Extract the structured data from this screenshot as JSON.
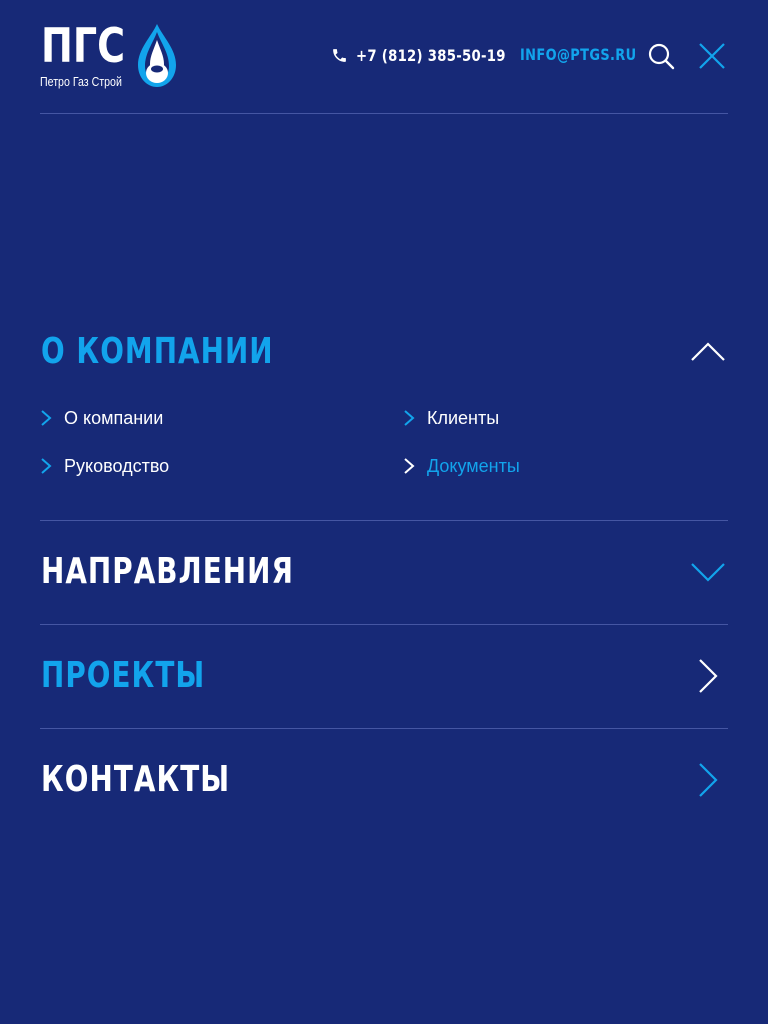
{
  "header": {
    "logo": {
      "letters": "ПГС",
      "subtitle": "Петро Газ Строй"
    },
    "phone": "+7 (812) 385-50-19",
    "email": "INFO@PTGS.RU",
    "icons": [
      "phone-icon",
      "search-icon",
      "close-icon"
    ]
  },
  "menu": {
    "sections": [
      {
        "title": "О КОМПАНИИ",
        "state": "expanded",
        "toggle_icon": "chevron-up-icon",
        "items": [
          {
            "label": "О компании",
            "color": "white"
          },
          {
            "label": "Клиенты",
            "color": "white"
          },
          {
            "label": "Руководство",
            "color": "white"
          },
          {
            "label": "Документы",
            "color": "blue"
          }
        ]
      },
      {
        "title": "НАПРАВЛЕНИЯ",
        "state": "collapsed",
        "toggle_icon": "chevron-down-icon"
      },
      {
        "title": "ПРОЕКТЫ",
        "state": "link",
        "toggle_icon": "chevron-right-icon"
      },
      {
        "title": "КОНТАКТЫ",
        "state": "link",
        "toggle_icon": "chevron-right-icon"
      }
    ]
  },
  "colors": {
    "background": "#172977",
    "accent": "#12a4ec",
    "text": "#ffffff",
    "divider": "#4556a3"
  }
}
